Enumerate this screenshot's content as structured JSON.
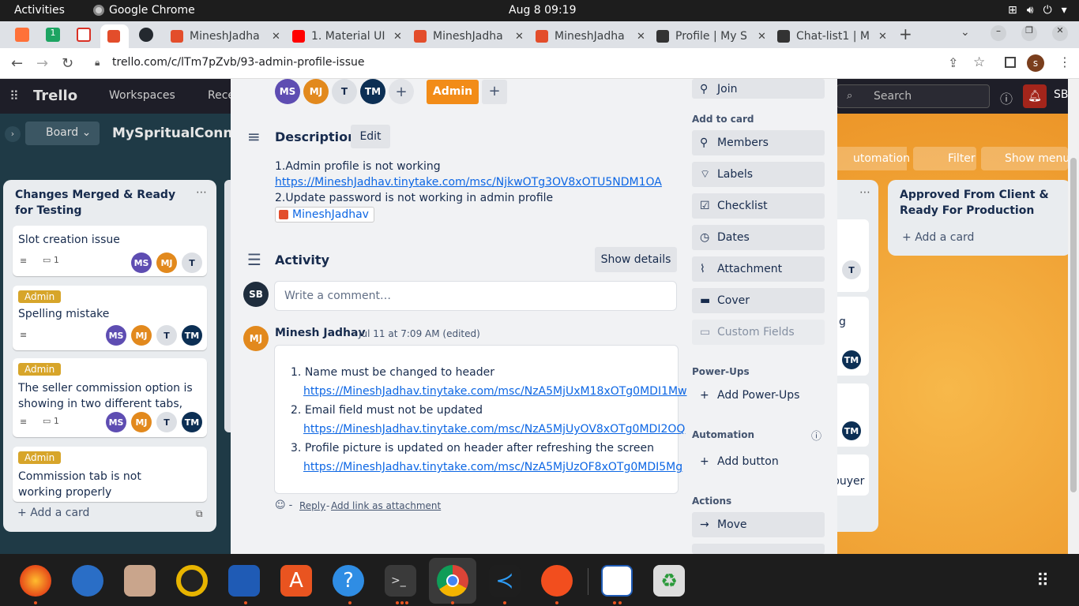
{
  "system": {
    "activities": "Activities",
    "app": "Google Chrome",
    "clock": "Aug 8  09:19"
  },
  "tabs": [
    {
      "label": "MineshJadha"
    },
    {
      "label": "1. Material UI"
    },
    {
      "label": "MineshJadha"
    },
    {
      "label": "MineshJadha"
    },
    {
      "label": "Profile | My S"
    },
    {
      "label": "Chat-list1 | M"
    }
  ],
  "address": {
    "url": "trello.com/c/lTm7pZvb/93-admin-profile-issue",
    "profile": "s"
  },
  "trello": {
    "logo": "Trello",
    "workspaces": "Workspaces",
    "recent": "Rece",
    "search": "Search",
    "user": "SB"
  },
  "board": {
    "view": "Board",
    "name": "MySpritualConne",
    "automation": "utomation",
    "filter": "Filter",
    "show_menu": "Show menu"
  },
  "list1": {
    "title": "Changes Merged & Ready for Testing",
    "add": "Add a card",
    "cards": [
      {
        "title": "Slot creation issue",
        "comments": "1"
      },
      {
        "label": "Admin",
        "title": "Spelling mistake"
      },
      {
        "label": "Admin",
        "title": "The seller commission option is showing in two different tabs,",
        "comments": "1"
      },
      {
        "label": "Admin",
        "title": "Commission tab is not working properly"
      }
    ]
  },
  "list3": {
    "title": "Approved From Client & Ready For Production",
    "add": "Add a card"
  },
  "peek": {
    "text1": "g",
    "text2": "buyer"
  },
  "members": [
    "MS",
    "MJ",
    "T",
    "TM"
  ],
  "member_colors": {
    "MS": "#5e4db2",
    "MJ": "#e2891d",
    "T": "#dcdfe4",
    "TM": "#0c2f54"
  },
  "card": {
    "label": "Admin",
    "label_color": "#f28c18",
    "description_heading": "Description",
    "edit": "Edit",
    "desc_line1": "1.Admin profile is not working",
    "desc_link1": "https://MineshJadhav.tinytake.com/msc/NjkwOTg3OV8xOTU5NDM1OA",
    "desc_line2": "2.Update password is not working in admin profile",
    "desc_chip": "MineshJadhav",
    "activity_heading": "Activity",
    "show_details": "Show details",
    "comment_avatar": "SB",
    "comment_placeholder": "Write a comment…",
    "commenter": {
      "initials": "MJ",
      "name": "Minesh Jadhav",
      "time": "Jul 11 at 7:09 AM (edited)"
    },
    "comment_items": [
      {
        "text": "Name must be changed to header",
        "link": "https://MineshJadhav.tinytake.com/msc/NzA5MjUxM18xOTg0MDI1Mw"
      },
      {
        "text": "Email field must not be updated",
        "link": "https://MineshJadhav.tinytake.com/msc/NzA5MjUyOV8xOTg0MDI2OQ"
      },
      {
        "text": "Profile picture is updated on header after refreshing the screen",
        "link": "https://MineshJadhav.tinytake.com/msc/NzA5MjUzOF8xOTg0MDI5Mg"
      }
    ],
    "reply": "Reply",
    "add_link": "Add link as attachment"
  },
  "sidebar": {
    "join": "Join",
    "add_to_card": "Add to card",
    "members": "Members",
    "labels": "Labels",
    "checklist": "Checklist",
    "dates": "Dates",
    "attachment": "Attachment",
    "cover": "Cover",
    "custom_fields": "Custom Fields",
    "powerups_heading": "Power-Ups",
    "add_powerups": "Add Power-Ups",
    "automation_heading": "Automation",
    "add_button": "Add button",
    "actions_heading": "Actions",
    "move": "Move"
  }
}
